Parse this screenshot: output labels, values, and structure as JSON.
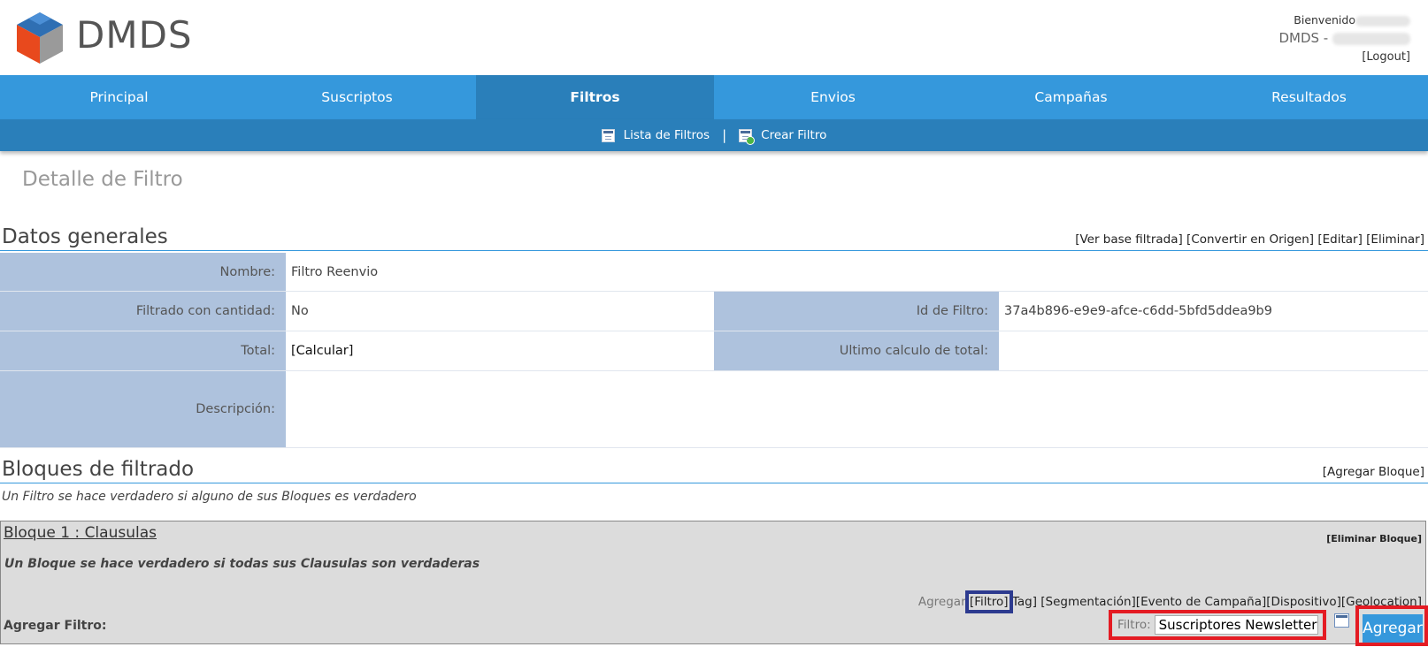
{
  "brand": "DMDS",
  "user": {
    "welcome": "Bienvenido",
    "dmds_prefix": "DMDS -",
    "logout": "[Logout]"
  },
  "nav": {
    "items": [
      "Principal",
      "Suscriptos",
      "Filtros",
      "Envios",
      "Campañas",
      "Resultados"
    ],
    "active": "Filtros"
  },
  "subnav": {
    "list": "Lista de Filtros",
    "separator": "|",
    "create": "Crear Filtro"
  },
  "page_title": "Detalle de Filtro",
  "general": {
    "title": "Datos generales",
    "actions": "[Ver base filtrada] [Convertir en Origen] [Editar] [Eliminar]",
    "nombre_label": "Nombre:",
    "nombre_value": "Filtro Reenvio",
    "cantidad_label": "Filtrado con cantidad:",
    "cantidad_value": "No",
    "id_label": "Id de Filtro:",
    "id_value": "37a4b896-e9e9-afce-c6dd-5bfd5ddea9b9",
    "total_label": "Total:",
    "total_value": "[Calcular]",
    "ultimo_label": "Ultimo calculo de total:",
    "ultimo_value": "",
    "descripcion_label": "Descripción:",
    "descripcion_value": ""
  },
  "bloques": {
    "title": "Bloques de filtrado",
    "action": "[Agregar Bloque]",
    "intro": "Un Filtro se hace verdadero si alguno de sus Bloques es verdadero",
    "bloque1": {
      "title": "Bloque 1 : Clausulas",
      "delete": "[Eliminar Bloque]",
      "desc": "Un Bloque se hace verdadero si todas sus Clausulas son verdaderas",
      "agregar": "Agregar",
      "opt_filtro": "[Filtro]",
      "opt_rest": "Tag]  [Segmentación][Evento de Campaña][Dispositivo][Geolocation]",
      "add_filter_label": "Agregar Filtro:",
      "filter_label": "Filtro:",
      "filter_value": "Suscriptores Newsletter",
      "add_button": "Agregar"
    }
  },
  "colors": {
    "nav_blue": "#3598dc",
    "nav_active": "#2a7fba",
    "label_bg": "#aec2dd",
    "highlight_red": "#e41b23",
    "highlight_navy": "#2c3a8f"
  }
}
